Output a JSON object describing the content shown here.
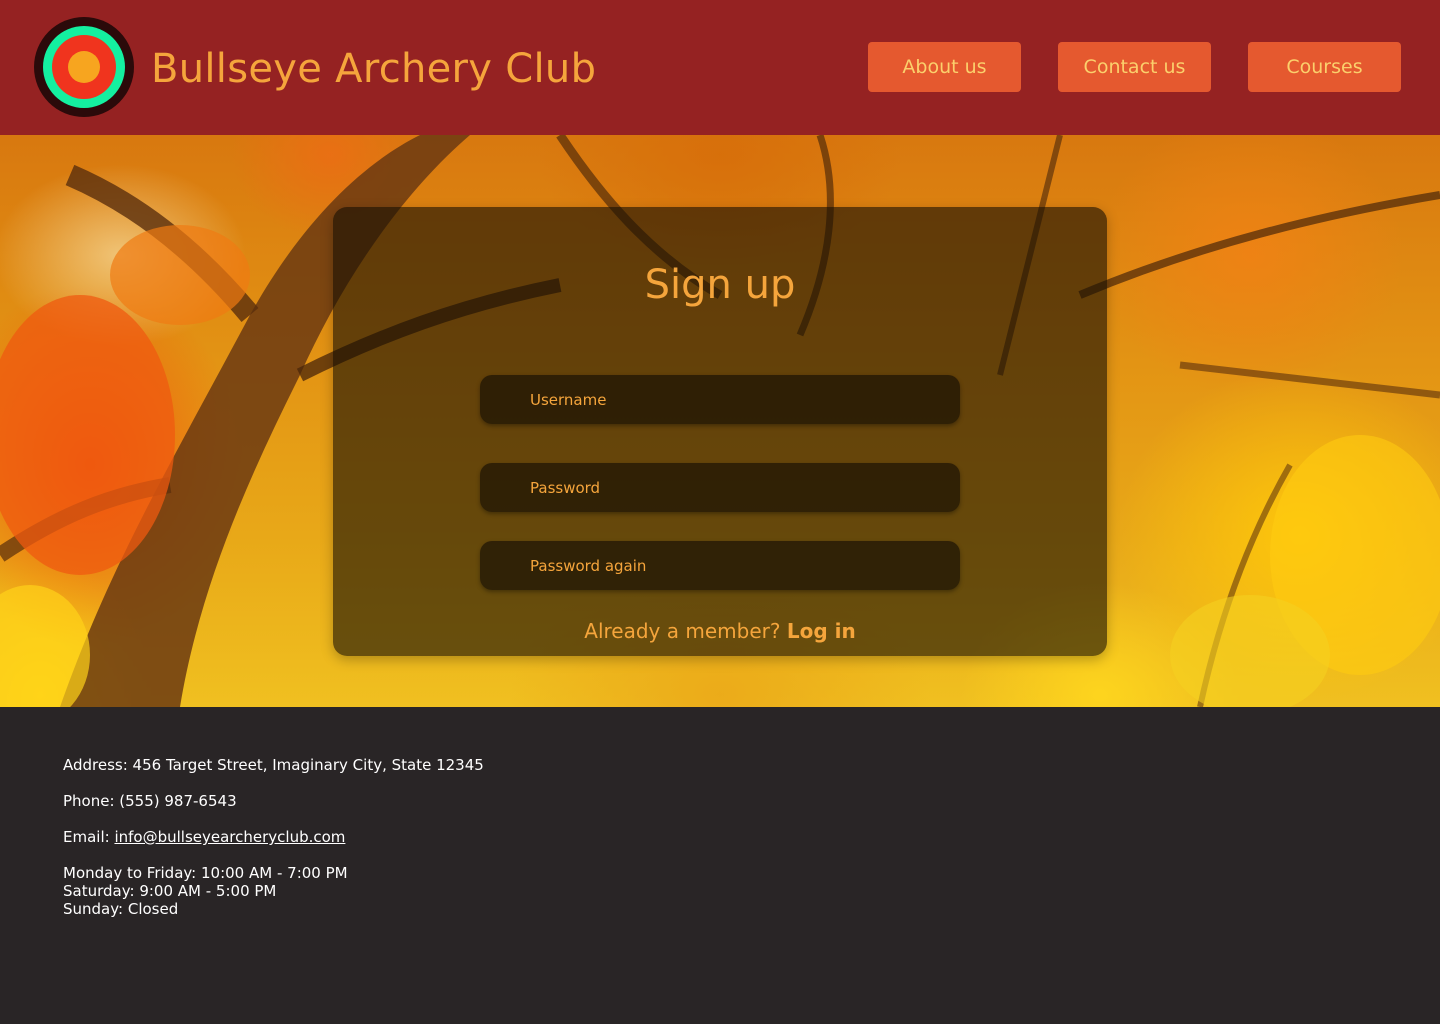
{
  "header": {
    "brand": "Bullseye Archery Club",
    "nav": [
      "About us",
      "Contact us",
      "Courses"
    ]
  },
  "signup": {
    "title": "Sign up",
    "username_placeholder": "Username",
    "password_placeholder": "Password",
    "password_again_placeholder": "Password again",
    "member_prompt": "Already a member?",
    "login_link": "Log in"
  },
  "footer": {
    "address": "Address: 456 Target Street, Imaginary City, State 12345",
    "phone": "Phone: (555) 987-6543",
    "email_label": "Email:",
    "email": "info@bullseyearcheryclub.com",
    "hours": [
      "Monday to Friday: 10:00 AM - 7:00 PM",
      "Saturday: 9:00 AM - 5:00 PM",
      "Sunday: Closed"
    ]
  },
  "colors": {
    "header_bg": "#952222",
    "accent_text": "#f5a53c",
    "button_bg": "#e5592f",
    "button_text": "#fbd06c",
    "footer_bg": "#292526",
    "logo_outer": "#2b0a0a",
    "logo_ring_teal": "#14f0a0",
    "logo_ring_red": "#f0341e",
    "logo_center": "#f7a51f"
  }
}
